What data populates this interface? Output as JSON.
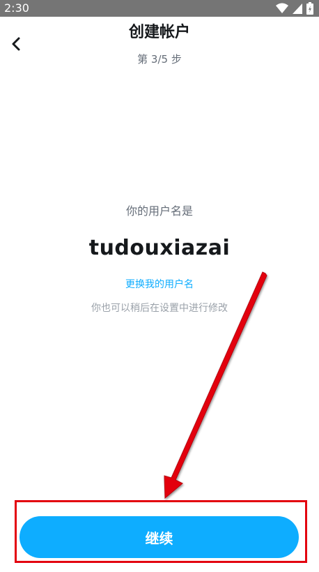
{
  "status_bar": {
    "time": "2:30",
    "icons": [
      "wifi-icon",
      "signal-icon",
      "battery-icon"
    ]
  },
  "header": {
    "back_icon": "chevron-left-icon",
    "title": "创建帐户",
    "step": "第 3/5 步"
  },
  "main": {
    "caption": "你的用户名是",
    "username": "tudouxiazai",
    "change_link": "更换我的用户名",
    "hint": "你也可以稍后在设置中进行修改"
  },
  "footer": {
    "continue_label": "继续"
  },
  "annotations": {
    "highlight_color": "#e3000f",
    "arrow_color": "#e3000f"
  },
  "colors": {
    "accent": "#0eadff",
    "status_bar": "#757575",
    "title_text": "#16191c",
    "secondary_text": "#656d78"
  }
}
